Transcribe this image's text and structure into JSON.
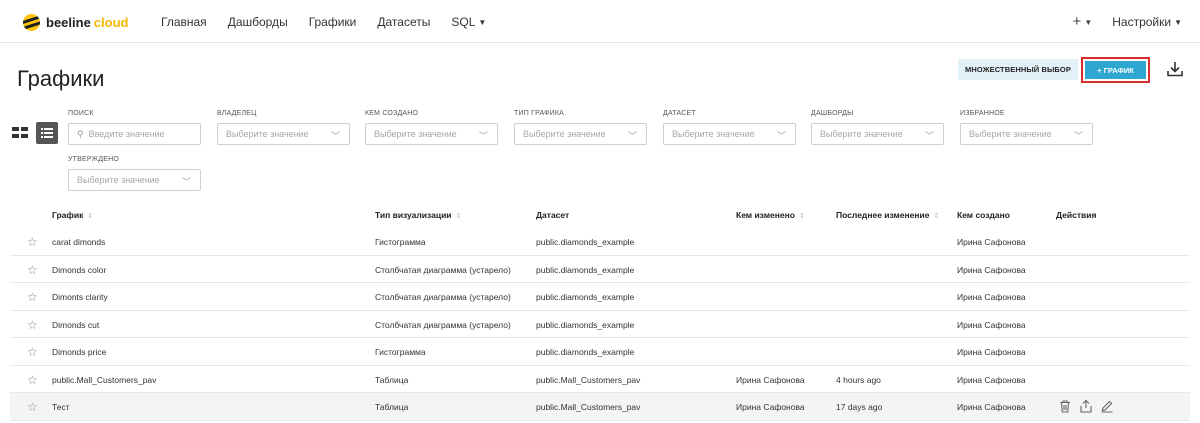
{
  "brand": {
    "name": "beeline",
    "suffix": "cloud"
  },
  "nav": {
    "items": [
      "Главная",
      "Дашборды",
      "Графики",
      "Датасеты",
      "SQL"
    ]
  },
  "topRight": {
    "plus": "+",
    "settings": "Настройки"
  },
  "page": {
    "title": "Графики"
  },
  "buttons": {
    "multi": "МНОЖЕСТВЕННЫЙ ВЫБОР",
    "chart": "+ ГРАФИК"
  },
  "filters": [
    {
      "label": "ПОИСК",
      "placeholder": "Введите значение",
      "icon": "search-icon"
    },
    {
      "label": "ВЛАДЕЛЕЦ",
      "placeholder": "Выберите значение"
    },
    {
      "label": "КЕМ СОЗДАНО",
      "placeholder": "Выберите значение"
    },
    {
      "label": "ТИП ГРАФИКА",
      "placeholder": "Выберите значение"
    },
    {
      "label": "ДАТАСЕТ",
      "placeholder": "Выберите значение"
    },
    {
      "label": "ДАШБОРДЫ",
      "placeholder": "Выберите значение"
    },
    {
      "label": "ИЗБРАННОЕ",
      "placeholder": "Выберите значение"
    },
    {
      "label": "УТВЕРЖДЕНО",
      "placeholder": "Выберите значение"
    }
  ],
  "table": {
    "headers": [
      "График",
      "Тип визуализации",
      "Датасет",
      "Кем изменено",
      "Последнее изменение",
      "Кем создано",
      "Действия"
    ],
    "rows": [
      {
        "name": "carat dimonds",
        "type": "Гистограмма",
        "dataset": "public.diamonds_example",
        "modifiedBy": "",
        "modified": "",
        "createdBy": "Ирина Сафонова"
      },
      {
        "name": "Dimonds color",
        "type": "Столбчатая диаграмма (устарело)",
        "dataset": "public.diamonds_example",
        "modifiedBy": "",
        "modified": "",
        "createdBy": "Ирина Сафонова"
      },
      {
        "name": "Dimonts clarity",
        "type": "Столбчатая диаграмма (устарело)",
        "dataset": "public.diamonds_example",
        "modifiedBy": "",
        "modified": "",
        "createdBy": "Ирина Сафонова"
      },
      {
        "name": "Dimonds cut",
        "type": "Столбчатая диаграмма (устарело)",
        "dataset": "public.diamonds_example",
        "modifiedBy": "",
        "modified": "",
        "createdBy": "Ирина Сафонова"
      },
      {
        "name": "Dimonds price",
        "type": "Гистограмма",
        "dataset": "public.diamonds_example",
        "modifiedBy": "",
        "modified": "",
        "createdBy": "Ирина Сафонова"
      },
      {
        "name": "public.Mall_Customers_pav",
        "type": "Таблица",
        "dataset": "public.Mall_Customers_pav",
        "modifiedBy": "Ирина Сафонова",
        "modified": "4 hours ago",
        "createdBy": "Ирина Сафонова"
      },
      {
        "name": "Тест",
        "type": "Таблица",
        "dataset": "public.Mall_Customers_pav",
        "modifiedBy": "Ирина Сафонова",
        "modified": "17 days ago",
        "createdBy": "Ирина Сафонова"
      }
    ]
  }
}
